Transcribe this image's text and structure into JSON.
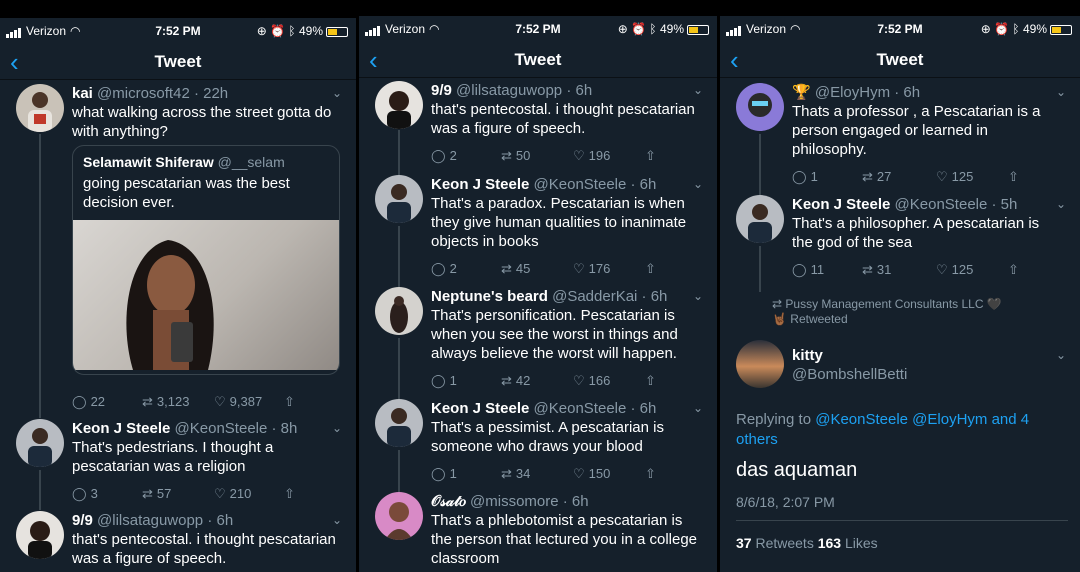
{
  "status": {
    "carrier": "Verizon",
    "time": "7:52 PM",
    "battery": "49%"
  },
  "header": {
    "title": "Tweet",
    "back": "‹"
  },
  "panel1": {
    "t1": {
      "name": "kai",
      "handle": "@microsoft42 · 22h",
      "text": "what walking across the street gotta do with anything?",
      "quote_name": "Selamawit Shiferaw",
      "quote_handle": "@__selam",
      "quote_text": "going pescatarian was the best decision ever.",
      "replies": "22",
      "retweets": "3,123",
      "likes": "9,387"
    },
    "t2": {
      "name": "Keon J Steele",
      "handle": "@KeonSteele · 8h",
      "text": "That's pedestrians. I thought a pescatarian was a religion",
      "replies": "3",
      "retweets": "57",
      "likes": "210"
    },
    "t3": {
      "name": "9/9",
      "handle": "@lilsataguwopp · 6h",
      "text": "that's pentecostal. i thought pescatarian was a figure of speech."
    }
  },
  "panel2": {
    "t1": {
      "name": "9/9",
      "handle": "@lilsataguwopp · 6h",
      "text": "that's pentecostal. i thought pescatarian was a figure of speech.",
      "replies": "2",
      "retweets": "50",
      "likes": "196"
    },
    "t2": {
      "name": "Keon J Steele",
      "handle": "@KeonSteele · 6h",
      "text": "That's a paradox. Pescatarian is when they give human qualities to inanimate objects in books",
      "replies": "2",
      "retweets": "45",
      "likes": "176"
    },
    "t3": {
      "name": "Neptune's beard",
      "handle": "@SadderKai · 6h",
      "text": "That's personification. Pescatarian is when you see the worst in things and always believe the worst will happen.",
      "replies": "1",
      "retweets": "42",
      "likes": "166"
    },
    "t4": {
      "name": "Keon J Steele",
      "handle": "@KeonSteele · 6h",
      "text": "That's a pessimist. A pescatarian is someone who draws your blood",
      "replies": "1",
      "retweets": "34",
      "likes": "150"
    },
    "t5": {
      "name": "𝒪𝓈𝒶𝓉𝑜",
      "handle": "@missomore · 6h",
      "text": "That's a phlebotomist a pescatarian is the person that lectured you in a college classroom"
    }
  },
  "panel3": {
    "t1": {
      "name": "🏆",
      "handle": "@EloyHym · 6h",
      "text": "Thats a professor , a Pescatarian is a person engaged or learned in philosophy.",
      "replies": "1",
      "retweets": "27",
      "likes": "125"
    },
    "t2": {
      "name": "Keon J Steele",
      "handle": "@KeonSteele · 5h",
      "text": "That's a philosopher. A pescatarian is the god of the sea",
      "replies": "11",
      "retweets": "31",
      "likes": "125"
    },
    "retweeted_by": "Pussy Management Consultants LLC 🖤",
    "retweeted_label": "🤘🏾 Retweeted",
    "focus": {
      "name": "kitty",
      "handle": "@BombshellBetti",
      "replying_label": "Replying to ",
      "replying_to": "@KeonSteele @EloyHym and 4 others",
      "text": "das aquaman",
      "timestamp": "8/6/18, 2:07 PM",
      "retweets_count": "37",
      "retweets_label": " Retweets ",
      "likes_count": "163",
      "likes_label": " Likes"
    }
  },
  "icons": {
    "reply": "reply-icon",
    "retweet": "retweet-icon",
    "like": "like-icon",
    "share": "share-icon"
  },
  "colors": {
    "background": "#15202b",
    "accent": "#1da1f2",
    "muted": "#8899a6",
    "divider": "#38444d"
  }
}
